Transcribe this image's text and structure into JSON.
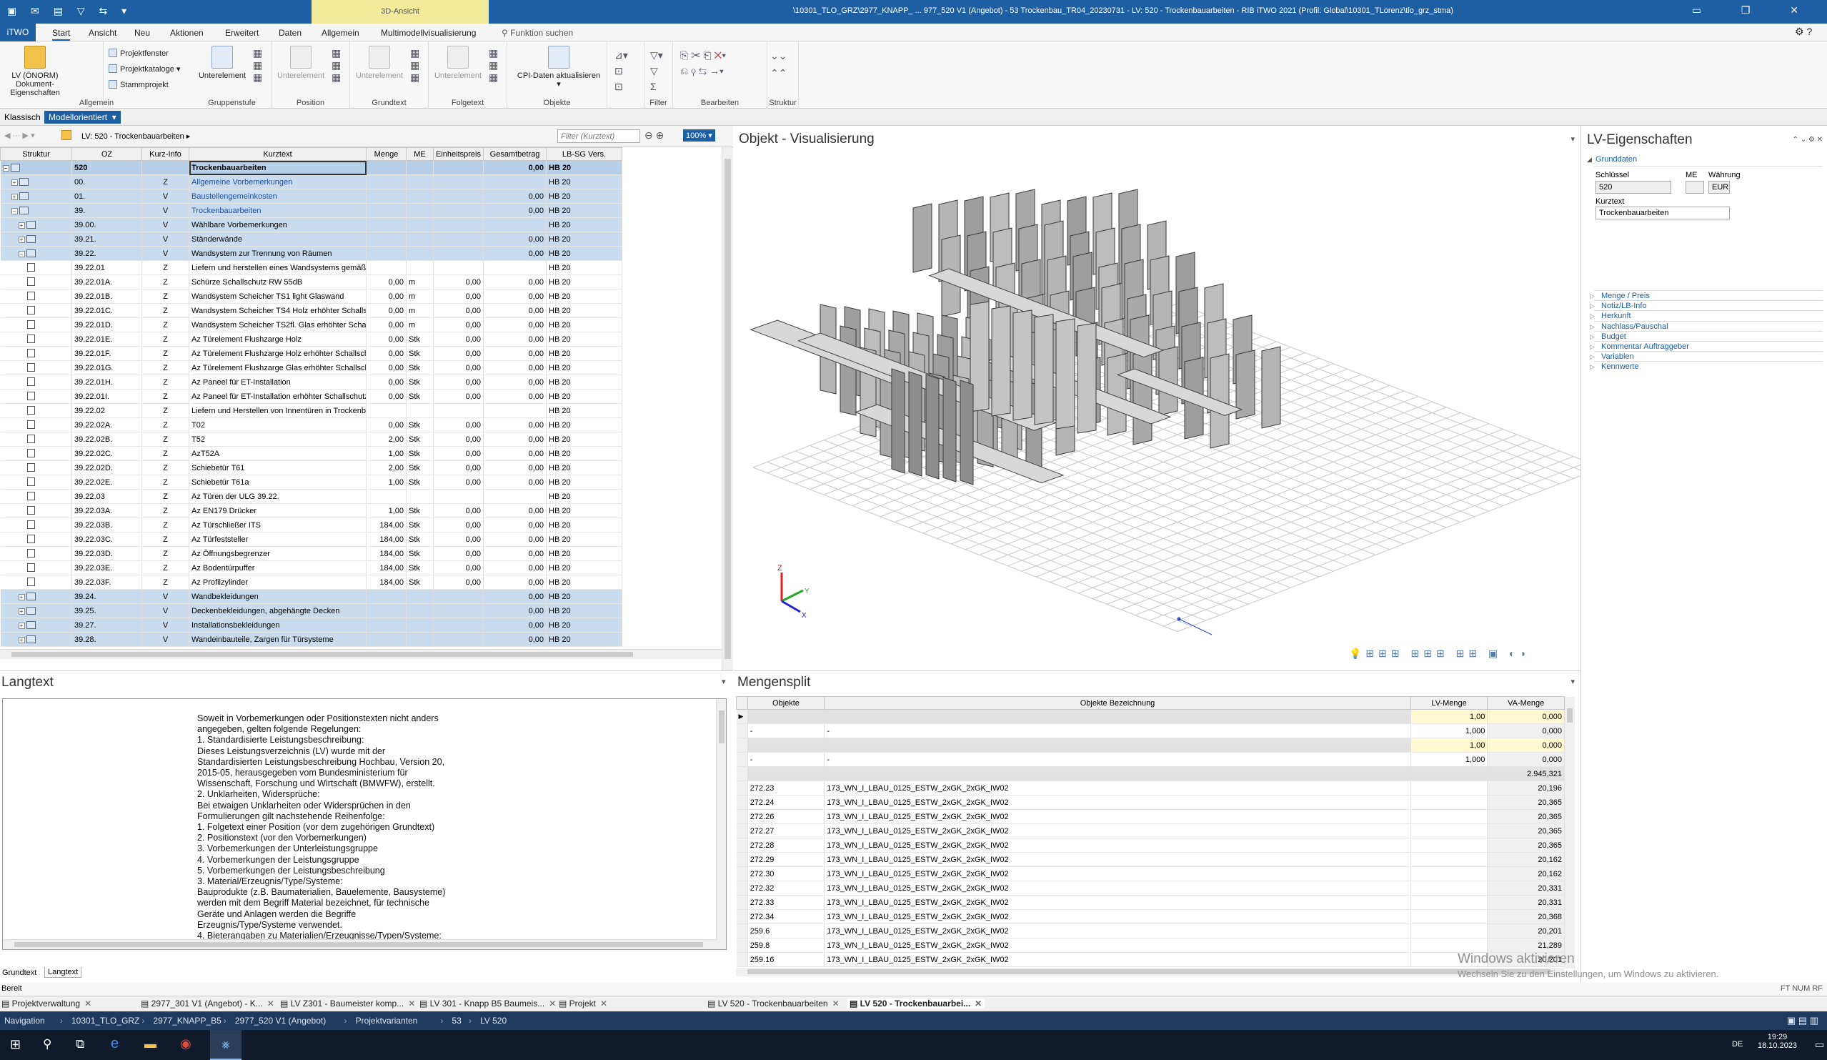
{
  "titlebar": {
    "context_tab": "3D-Ansicht",
    "title": "\\10301_TLO_GRZ\\2977_KNAPP_ ... 977_520 V1 (Angebot) - 53 Trockenbau_TR04_20230731 - LV: 520 - Trockenbauarbeiten - RIB iTWO 2021 (Profil: Global\\10301_TLorenz\\tlo_grz_stma)"
  },
  "ribbon_tabs": [
    "iTWO",
    "Start",
    "Ansicht",
    "Neu",
    "Aktionen",
    "Erweitert",
    "Daten",
    "Allgemein",
    "Multimodellvisualisierung",
    "Funktion suchen"
  ],
  "ribbon": {
    "allgemein": {
      "big": "LV (ÖNORM) Dokument-Eigenschaften",
      "small": [
        "Projektfenster",
        "Projektkataloge",
        "Stammprojekt"
      ],
      "label": "Allgemein"
    },
    "gruppenstufe": {
      "big": "Unterelement",
      "label": "Gruppenstufe"
    },
    "position": {
      "big": "Unterelement",
      "label": "Position"
    },
    "grundtext": {
      "big": "Unterelement",
      "label": "Grundtext"
    },
    "folgetext": {
      "big": "Unterelement",
      "label": "Folgetext"
    },
    "objekte": {
      "big": "CPI-Daten aktualisieren",
      "label": "Objekte"
    },
    "filter": {
      "label": "Filter"
    },
    "bearbeiten": {
      "label": "Bearbeiten"
    },
    "struktur": {
      "label": "Struktur"
    }
  },
  "modes": [
    "Klassisch",
    "Modellorientiert"
  ],
  "lv_toolbar": {
    "breadcrumb": "LV: 520 - Trockenbauarbeiten",
    "filter_placeholder": "Filter (Kurztext)",
    "zoom": "100%"
  },
  "lv_grid": {
    "columns": [
      "Struktur",
      "OZ",
      "Kurz-Info",
      "Kurztext",
      "Menge",
      "ME",
      "Einheitspreis",
      "Gesamtbetrag",
      "LB-SG Vers."
    ],
    "rows": [
      {
        "t": "root",
        "oz": "520",
        "ki": "",
        "kt": "Trockenbauarbeiten",
        "m": "",
        "me": "",
        "ep": "",
        "gb": "0,00",
        "lb": "HB 20"
      },
      {
        "t": "v",
        "oz": "00.",
        "ki": "Z",
        "kt": "Allgemeine Vorbemerkungen",
        "m": "",
        "me": "",
        "ep": "",
        "gb": "",
        "lb": "HB 20"
      },
      {
        "t": "v",
        "oz": "01.",
        "ki": "V",
        "kt": "Baustellengemeinkosten",
        "m": "",
        "me": "",
        "ep": "",
        "gb": "0,00",
        "lb": "HB 20"
      },
      {
        "t": "v",
        "oz": "39.",
        "ki": "V",
        "kt": "Trockenbauarbeiten",
        "m": "",
        "me": "",
        "ep": "",
        "gb": "0,00",
        "lb": "HB 20"
      },
      {
        "t": "v",
        "oz": "39.00.",
        "ki": "V",
        "kt": "Wählbare Vorbemerkungen",
        "m": "",
        "me": "",
        "ep": "",
        "gb": "",
        "lb": "HB 20"
      },
      {
        "t": "v",
        "oz": "39.21.",
        "ki": "V",
        "kt": "Ständerwände",
        "m": "",
        "me": "",
        "ep": "",
        "gb": "0,00",
        "lb": "HB 20"
      },
      {
        "t": "v",
        "oz": "39.22.",
        "ki": "V",
        "kt": "Wandsystem zur Trennung von Räumen",
        "m": "",
        "me": "",
        "ep": "",
        "gb": "0,00",
        "lb": "HB 20"
      },
      {
        "t": "p",
        "oz": "39.22.01",
        "ki": "Z",
        "kt": "Liefern und herstellen eines Wandsystems gemäß F",
        "m": "",
        "me": "",
        "ep": "",
        "gb": "",
        "lb": "HB 20"
      },
      {
        "t": "p",
        "oz": "39.22.01A.",
        "ki": "Z",
        "kt": "Schürze Schallschutz RW 55dB",
        "m": "0,00",
        "me": "m",
        "ep": "0,00",
        "gb": "0,00",
        "lb": "HB 20"
      },
      {
        "t": "p",
        "oz": "39.22.01B.",
        "ki": "Z",
        "kt": "Wandsystem Scheicher TS1 light Glaswand",
        "m": "0,00",
        "me": "m",
        "ep": "0,00",
        "gb": "0,00",
        "lb": "HB 20"
      },
      {
        "t": "p",
        "oz": "39.22.01C.",
        "ki": "Z",
        "kt": "Wandsystem Scheicher TS4 Holz erhöhter Schallsc",
        "m": "0,00",
        "me": "m",
        "ep": "0,00",
        "gb": "0,00",
        "lb": "HB 20"
      },
      {
        "t": "p",
        "oz": "39.22.01D.",
        "ki": "Z",
        "kt": "Wandsystem Scheicher TS2fl. Glas erhöhter Schal",
        "m": "0,00",
        "me": "m",
        "ep": "0,00",
        "gb": "0,00",
        "lb": "HB 20"
      },
      {
        "t": "p",
        "oz": "39.22.01E.",
        "ki": "Z",
        "kt": "Az Türelement Flushzarge Holz",
        "m": "0,00",
        "me": "Stk",
        "ep": "0,00",
        "gb": "0,00",
        "lb": "HB 20"
      },
      {
        "t": "p",
        "oz": "39.22.01F.",
        "ki": "Z",
        "kt": "Az Türelement Flushzarge Holz erhöhter Schallschu",
        "m": "0,00",
        "me": "Stk",
        "ep": "0,00",
        "gb": "0,00",
        "lb": "HB 20"
      },
      {
        "t": "p",
        "oz": "39.22.01G.",
        "ki": "Z",
        "kt": "Az Türelement Flushzarge Glas erhöhter Schallschu",
        "m": "0,00",
        "me": "Stk",
        "ep": "0,00",
        "gb": "0,00",
        "lb": "HB 20"
      },
      {
        "t": "p",
        "oz": "39.22.01H.",
        "ki": "Z",
        "kt": "Az Paneel für ET-Installation",
        "m": "0,00",
        "me": "Stk",
        "ep": "0,00",
        "gb": "0,00",
        "lb": "HB 20"
      },
      {
        "t": "p",
        "oz": "39.22.01I.",
        "ki": "Z",
        "kt": "Az Paneel für ET-Installation erhöhter Schallschutz",
        "m": "0,00",
        "me": "Stk",
        "ep": "0,00",
        "gb": "0,00",
        "lb": "HB 20"
      },
      {
        "t": "p",
        "oz": "39.22.02",
        "ki": "Z",
        "kt": "Liefern und Herstellen von Innentüren in Trockenba",
        "m": "",
        "me": "",
        "ep": "",
        "gb": "",
        "lb": "HB 20"
      },
      {
        "t": "p",
        "oz": "39.22.02A.",
        "ki": "Z",
        "kt": "T02",
        "m": "0,00",
        "me": "Stk",
        "ep": "0,00",
        "gb": "0,00",
        "lb": "HB 20"
      },
      {
        "t": "p",
        "oz": "39.22.02B.",
        "ki": "Z",
        "kt": "T52",
        "m": "2,00",
        "me": "Stk",
        "ep": "0,00",
        "gb": "0,00",
        "lb": "HB 20"
      },
      {
        "t": "p",
        "oz": "39.22.02C.",
        "ki": "Z",
        "kt": "AzT52A",
        "m": "1,00",
        "me": "Stk",
        "ep": "0,00",
        "gb": "0,00",
        "lb": "HB 20"
      },
      {
        "t": "p",
        "oz": "39.22.02D.",
        "ki": "Z",
        "kt": "Schiebetür T61",
        "m": "2,00",
        "me": "Stk",
        "ep": "0,00",
        "gb": "0,00",
        "lb": "HB 20"
      },
      {
        "t": "p",
        "oz": "39.22.02E.",
        "ki": "Z",
        "kt": "Schiebetür T61a",
        "m": "1,00",
        "me": "Stk",
        "ep": "0,00",
        "gb": "0,00",
        "lb": "HB 20"
      },
      {
        "t": "p",
        "oz": "39.22.03",
        "ki": "Z",
        "kt": "Az Türen der ULG 39.22.",
        "m": "",
        "me": "",
        "ep": "",
        "gb": "",
        "lb": "HB 20"
      },
      {
        "t": "p",
        "oz": "39.22.03A.",
        "ki": "Z",
        "kt": "Az EN179 Drücker",
        "m": "1,00",
        "me": "Stk",
        "ep": "0,00",
        "gb": "0,00",
        "lb": "HB 20"
      },
      {
        "t": "p",
        "oz": "39.22.03B.",
        "ki": "Z",
        "kt": "Az Türschließer ITS",
        "m": "184,00",
        "me": "Stk",
        "ep": "0,00",
        "gb": "0,00",
        "lb": "HB 20"
      },
      {
        "t": "p",
        "oz": "39.22.03C.",
        "ki": "Z",
        "kt": "Az Türfeststeller",
        "m": "184,00",
        "me": "Stk",
        "ep": "0,00",
        "gb": "0,00",
        "lb": "HB 20"
      },
      {
        "t": "p",
        "oz": "39.22.03D.",
        "ki": "Z",
        "kt": "Az Öffnungsbegrenzer",
        "m": "184,00",
        "me": "Stk",
        "ep": "0,00",
        "gb": "0,00",
        "lb": "HB 20"
      },
      {
        "t": "p",
        "oz": "39.22.03E.",
        "ki": "Z",
        "kt": "Az Bodentürpuffer",
        "m": "184,00",
        "me": "Stk",
        "ep": "0,00",
        "gb": "0,00",
        "lb": "HB 20"
      },
      {
        "t": "p",
        "oz": "39.22.03F.",
        "ki": "Z",
        "kt": "Az Profilzylinder",
        "m": "184,00",
        "me": "Stk",
        "ep": "0,00",
        "gb": "0,00",
        "lb": "HB 20"
      },
      {
        "t": "v",
        "oz": "39.24.",
        "ki": "V",
        "kt": "Wandbekleidungen",
        "m": "",
        "me": "",
        "ep": "",
        "gb": "0,00",
        "lb": "HB 20"
      },
      {
        "t": "v",
        "oz": "39.25.",
        "ki": "V",
        "kt": "Deckenbekleidungen, abgehängte Decken",
        "m": "",
        "me": "",
        "ep": "",
        "gb": "0,00",
        "lb": "HB 20"
      },
      {
        "t": "v",
        "oz": "39.27.",
        "ki": "V",
        "kt": "Installationsbekleidungen",
        "m": "",
        "me": "",
        "ep": "",
        "gb": "0,00",
        "lb": "HB 20"
      },
      {
        "t": "v",
        "oz": "39.28.",
        "ki": "V",
        "kt": "Wandeinbauteile, Zargen für Türsysteme",
        "m": "",
        "me": "",
        "ep": "",
        "gb": "0,00",
        "lb": "HB 20"
      }
    ]
  },
  "viz": {
    "title": "Objekt - Visualisierung"
  },
  "props": {
    "title": "LV-Eigenschaften",
    "section": "Grunddaten",
    "schluessel_label": "Schlüssel",
    "schluessel": "520",
    "me_label": "ME",
    "waehrung_label": "Währung",
    "waehrung": "EUR",
    "kurztext_label": "Kurztext",
    "kurztext": "Trockenbauarbeiten",
    "links": [
      "Menge / Preis",
      "Notiz/LB-Info",
      "Herkunft",
      "Nachlass/Pauschal",
      "Budget",
      "Kommentar Auftraggeber",
      "Variablen",
      "Kennwerte"
    ]
  },
  "langtext": {
    "title": "Langtext",
    "tabs": [
      "Grundtext",
      "Langtext"
    ],
    "text": "Soweit in Vorbemerkungen oder Positionstexten nicht anders\nangegeben, gelten folgende Regelungen:\n1. Standardisierte Leistungsbeschreibung:\nDieses Leistungsverzeichnis (LV) wurde mit der\nStandardisierten Leistungsbeschreibung Hochbau, Version 20,\n2015-05, herausgegeben vom Bundesministerium für\nWissenschaft, Forschung und Wirtschaft (BMWFW), erstellt.\n2. Unklarheiten, Widersprüche:\nBei etwaigen Unklarheiten oder Widersprüchen in den\nFormulierungen gilt nachstehende Reihenfolge:\n 1. Folgetext einer Position (vor dem zugehörigen Grundtext)\n 2. Positionstext (vor den Vorbemerkungen)\n 3. Vorbemerkungen der Unterleistungsgruppe\n 4. Vorbemerkungen der Leistungsgruppe\n 5. Vorbemerkungen der Leistungsbeschreibung\n3. Material/Erzeugnis/Type/Systeme:\nBauprodukte (z.B. Baumaterialien, Bauelemente, Bausysteme)\nwerden mit dem Begriff Material bezeichnet, für technische\nGeräte und Anlagen werden die Begriffe\nErzeugnis/Type/Systeme verwendet.\n4. Bieterangaben zu Materialien/Erzeugnisse/Typen/Systeme:"
  },
  "mengensplit": {
    "title": "Mengensplit",
    "columns": [
      "Objekte",
      "Objekte Bezeichnung",
      "LV-Menge",
      "VA-Menge"
    ],
    "rows": [
      {
        "o": "",
        "b": "",
        "lv": "1,00",
        "va": "0,000",
        "hl": true,
        "arrow": "▶"
      },
      {
        "o": "-",
        "b": "-",
        "lv": "1,000",
        "va": "0,000",
        "hl": false,
        "arrow": ""
      },
      {
        "o": "",
        "b": "",
        "lv": "1,00",
        "va": "0,000",
        "hl": true,
        "arrow": ""
      },
      {
        "o": "-",
        "b": "-",
        "lv": "1,000",
        "va": "0,000",
        "hl": false,
        "arrow": ""
      },
      {
        "o": "",
        "b": "",
        "lv": "",
        "va": "2.945,321",
        "hl": false,
        "arrow": ""
      },
      {
        "o": "272.23",
        "b": "173_WN_I_LBAU_0125_ESTW_2xGK_2xGK_IW02",
        "lv": "",
        "va": "20,196",
        "hl": false,
        "arrow": ""
      },
      {
        "o": "272.24",
        "b": "173_WN_I_LBAU_0125_ESTW_2xGK_2xGK_IW02",
        "lv": "",
        "va": "20,365",
        "hl": false,
        "arrow": ""
      },
      {
        "o": "272.26",
        "b": "173_WN_I_LBAU_0125_ESTW_2xGK_2xGK_IW02",
        "lv": "",
        "va": "20,365",
        "hl": false,
        "arrow": ""
      },
      {
        "o": "272.27",
        "b": "173_WN_I_LBAU_0125_ESTW_2xGK_2xGK_IW02",
        "lv": "",
        "va": "20,365",
        "hl": false,
        "arrow": ""
      },
      {
        "o": "272.28",
        "b": "173_WN_I_LBAU_0125_ESTW_2xGK_2xGK_IW02",
        "lv": "",
        "va": "20,365",
        "hl": false,
        "arrow": ""
      },
      {
        "o": "272.29",
        "b": "173_WN_I_LBAU_0125_ESTW_2xGK_2xGK_IW02",
        "lv": "",
        "va": "20,162",
        "hl": false,
        "arrow": ""
      },
      {
        "o": "272.30",
        "b": "173_WN_I_LBAU_0125_ESTW_2xGK_2xGK_IW02",
        "lv": "",
        "va": "20,162",
        "hl": false,
        "arrow": ""
      },
      {
        "o": "272.32",
        "b": "173_WN_I_LBAU_0125_ESTW_2xGK_2xGK_IW02",
        "lv": "",
        "va": "20,331",
        "hl": false,
        "arrow": ""
      },
      {
        "o": "272.33",
        "b": "173_WN_I_LBAU_0125_ESTW_2xGK_2xGK_IW02",
        "lv": "",
        "va": "20,331",
        "hl": false,
        "arrow": ""
      },
      {
        "o": "272.34",
        "b": "173_WN_I_LBAU_0125_ESTW_2xGK_2xGK_IW02",
        "lv": "",
        "va": "20,368",
        "hl": false,
        "arrow": ""
      },
      {
        "o": "259.6",
        "b": "173_WN_I_LBAU_0125_ESTW_2xGK_2xGK_IW02",
        "lv": "",
        "va": "20,201",
        "hl": false,
        "arrow": ""
      },
      {
        "o": "259.8",
        "b": "173_WN_I_LBAU_0125_ESTW_2xGK_2xGK_IW02",
        "lv": "",
        "va": "21,289",
        "hl": false,
        "arrow": ""
      },
      {
        "o": "259.16",
        "b": "173_WN_I_LBAU_0125_ESTW_2xGK_2xGK_IW02",
        "lv": "",
        "va": "20,201",
        "hl": false,
        "arrow": ""
      }
    ]
  },
  "watermark": {
    "line1": "Windows aktivieren",
    "line2": "Wechseln Sie zu den Einstellungen, um Windows zu aktivieren."
  },
  "status": {
    "left": "Bereit",
    "right": "FT  NUM  RF"
  },
  "doc_tabs": [
    "Projektverwaltung",
    "2977_301 V1 (Angebot) - K...",
    "LV Z301 - Baumeister komp...",
    "LV 301 - Knapp B5 Baumeis...",
    "Projekt",
    "LV 520 - Trockenbauarbeiten",
    "LV 520 - Trockenbauarbei..."
  ],
  "navbar": [
    "Navigation",
    "10301_TLO_GRZ",
    "2977_KNAPP_B5",
    "2977_520 V1 (Angebot)",
    "Projektvarianten",
    "53",
    "LV 520"
  ],
  "taskbar": {
    "lang": "DE",
    "time": "19:29",
    "date": "18.10.2023"
  }
}
